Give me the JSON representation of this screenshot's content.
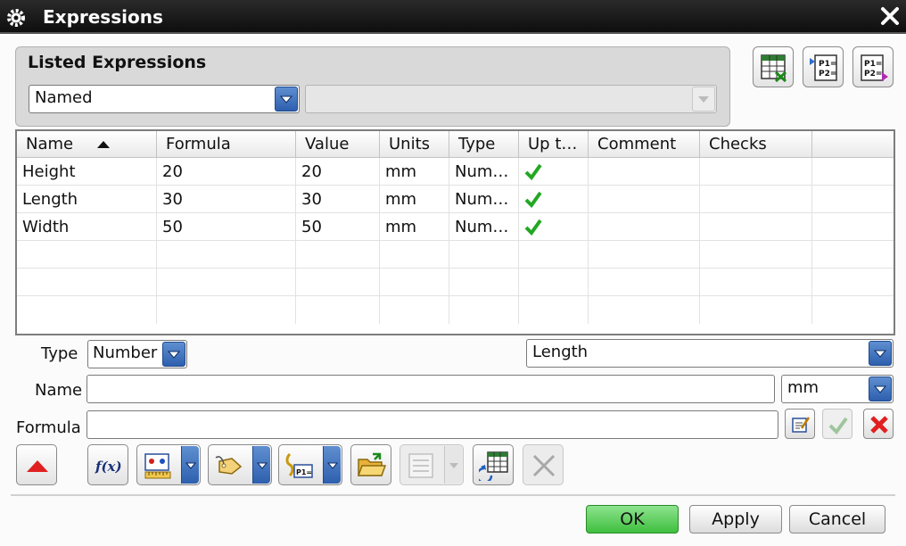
{
  "window": {
    "title": "Expressions",
    "icons": {
      "app": "gear-icon",
      "close": "close-icon"
    }
  },
  "listed_group": {
    "label": "Listed Expressions",
    "filter_value": "Named",
    "secondary_value": ""
  },
  "top_tools": [
    {
      "name": "spreadsheet-edit-icon"
    },
    {
      "name": "import-expressions-icon"
    },
    {
      "name": "export-expressions-icon"
    }
  ],
  "table": {
    "columns": [
      "Name",
      "Formula",
      "Value",
      "Units",
      "Type",
      "Up t…",
      "Comment",
      "Checks",
      ""
    ],
    "sort_column": "Name",
    "rows": [
      {
        "name": "Height",
        "formula": "20",
        "value": "20",
        "units": "mm",
        "type": "Num…",
        "uptodate": "check-icon",
        "comment": "",
        "checks": ""
      },
      {
        "name": "Length",
        "formula": "30",
        "value": "30",
        "units": "mm",
        "type": "Num…",
        "uptodate": "check-icon",
        "comment": "",
        "checks": ""
      },
      {
        "name": "Width",
        "formula": "50",
        "value": "50",
        "units": "mm",
        "type": "Num…",
        "uptodate": "check-icon",
        "comment": "",
        "checks": ""
      }
    ],
    "empty_rows": 3
  },
  "editor": {
    "type_label": "Type",
    "type_value": "Number",
    "dimension_value": "Length",
    "name_label": "Name",
    "name_value": "",
    "units_value": "mm",
    "formula_label": "Formula",
    "formula_value": ""
  },
  "bottom_tools": [
    "collapse-up-icon",
    "function-icon",
    "measure-icon",
    "attribute-icon",
    "parameter-icon",
    "open-folder-icon",
    "list-icon",
    "refresh-spreadsheet-icon",
    "delete-icon"
  ],
  "buttons": {
    "ok": "OK",
    "apply": "Apply",
    "cancel": "Cancel"
  },
  "colors": {
    "titlebar": "#111111",
    "combo_arrow": "#3a6cc0",
    "ok_button": "#5ccf5c",
    "check": "#22a822",
    "reject": "#e02020"
  }
}
